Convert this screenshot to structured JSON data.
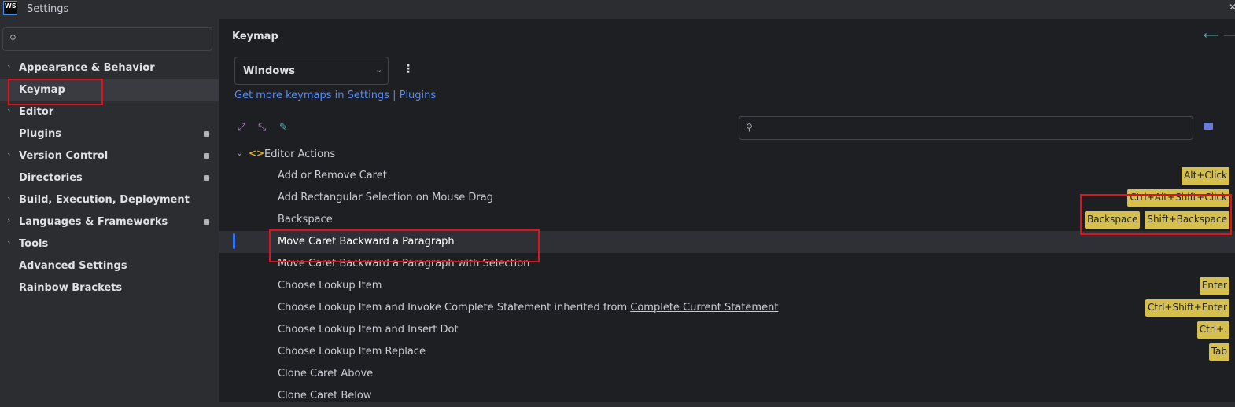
{
  "window": {
    "logo": "WS",
    "title": "Settings"
  },
  "sidebar": {
    "search_placeholder": "",
    "items": [
      {
        "label": "Appearance & Behavior",
        "expandable": true,
        "badge": false
      },
      {
        "label": "Keymap",
        "expandable": false,
        "badge": false,
        "selected": true
      },
      {
        "label": "Editor",
        "expandable": true,
        "badge": false
      },
      {
        "label": "Plugins",
        "expandable": false,
        "badge": true
      },
      {
        "label": "Version Control",
        "expandable": true,
        "badge": true
      },
      {
        "label": "Directories",
        "expandable": false,
        "badge": true
      },
      {
        "label": "Build, Execution, Deployment",
        "expandable": true,
        "badge": false
      },
      {
        "label": "Languages & Frameworks",
        "expandable": true,
        "badge": true
      },
      {
        "label": "Tools",
        "expandable": true,
        "badge": false
      },
      {
        "label": "Advanced Settings",
        "expandable": false,
        "badge": false
      },
      {
        "label": "Rainbow Brackets",
        "expandable": false,
        "badge": false
      }
    ]
  },
  "main": {
    "title": "Keymap",
    "keymap_select": {
      "value": "Windows"
    },
    "more_link": "Get more keymaps in Settings | Plugins",
    "search_placeholder": "",
    "tree": {
      "group": "Editor Actions",
      "actions": [
        {
          "name": "Add or Remove Caret",
          "shortcuts": [
            "Alt+Click"
          ]
        },
        {
          "name": "Add Rectangular Selection on Mouse Drag",
          "shortcuts": [
            "Ctrl+Alt+Shift+Click"
          ]
        },
        {
          "name": "Backspace",
          "shortcuts": [
            "Backspace",
            "Shift+Backspace"
          ]
        },
        {
          "name": "Move Caret Backward a Paragraph",
          "shortcuts": [],
          "selected": true
        },
        {
          "name": "Move Caret Backward a Paragraph with Selection",
          "shortcuts": []
        },
        {
          "name": "Choose Lookup Item",
          "shortcuts": [
            "Enter"
          ]
        },
        {
          "name": "Choose Lookup Item and Invoke Complete Statement inherited from ",
          "link": "Complete Current Statement",
          "shortcuts": [
            "Ctrl+Shift+Enter"
          ]
        },
        {
          "name": "Choose Lookup Item and Insert Dot",
          "shortcuts": [
            "Ctrl+."
          ]
        },
        {
          "name": "Choose Lookup Item Replace",
          "shortcuts": [
            "Tab"
          ]
        },
        {
          "name": "Clone Caret Above",
          "shortcuts": []
        },
        {
          "name": "Clone Caret Below",
          "shortcuts": []
        }
      ]
    }
  },
  "colors": {
    "annotation": "#e0121b",
    "shortcut_bg": "#d6c04b",
    "link": "#548af7",
    "selection_indicator": "#3574f0"
  },
  "icons": [
    "search-icon",
    "expand-all-icon",
    "collapse-all-icon",
    "edit-icon",
    "keyboard-icon",
    "back-arrow-icon",
    "forward-arrow-icon",
    "more-options-icon",
    "code-brackets-icon"
  ]
}
